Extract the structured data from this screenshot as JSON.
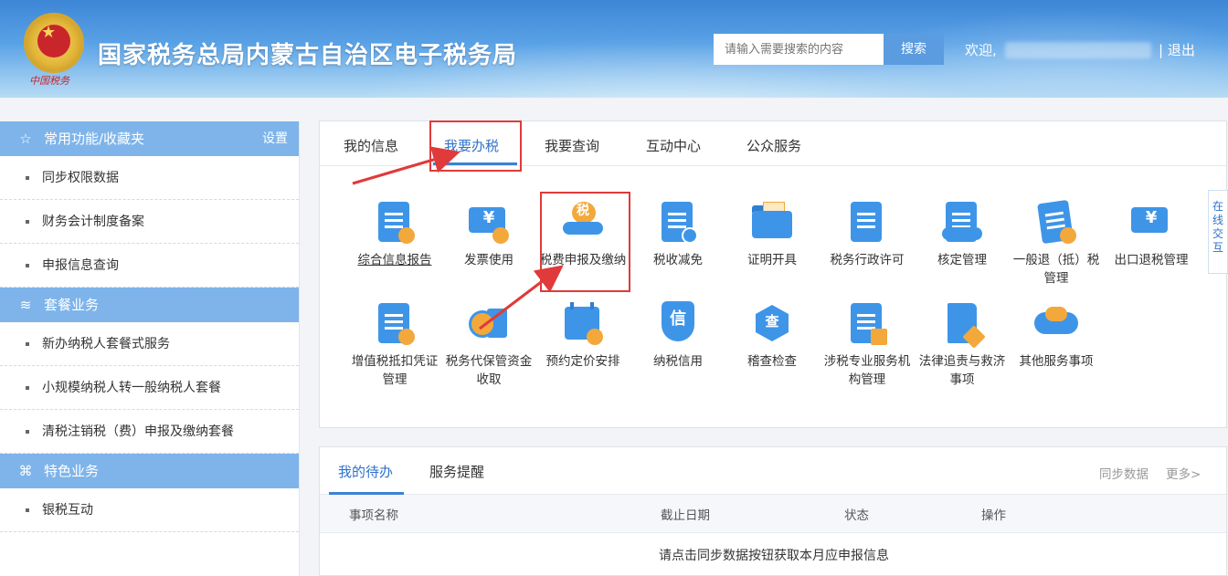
{
  "header": {
    "emblem_caption": "中国税务",
    "title": "国家税务总局内蒙古自治区电子税务局",
    "search": {
      "placeholder": "请输入需要搜索的内容",
      "button": "搜索"
    },
    "welcome": "欢迎,",
    "logout": "| 退出"
  },
  "sidebar": {
    "sections": [
      {
        "title": "常用功能/收藏夹",
        "icon": "star-icon",
        "setting": "设置",
        "items": [
          "同步权限数据",
          "财务会计制度备案",
          "申报信息查询"
        ]
      },
      {
        "title": "套餐业务",
        "icon": "layers-icon",
        "items": [
          "新办纳税人套餐式服务",
          "小规模纳税人转一般纳税人套餐",
          "清税注销税（费）申报及缴纳套餐"
        ]
      },
      {
        "title": "特色业务",
        "icon": "command-icon",
        "items": [
          "银税互动"
        ]
      }
    ]
  },
  "main": {
    "tabs": [
      "我的信息",
      "我要办税",
      "我要查询",
      "互动中心",
      "公众服务"
    ],
    "active_tab": "我要办税",
    "grid": {
      "row1": [
        "综合信息报告",
        "发票使用",
        "税费申报及缴纳",
        "税收减免",
        "证明开具",
        "税务行政许可",
        "核定管理",
        "一般退（抵）税管理",
        "出口退税管理"
      ],
      "row2": [
        "增值税抵扣凭证管理",
        "税务代保管资金收取",
        "预约定价安排",
        "纳税信用",
        "稽查检查",
        "涉税专业服务机构管理",
        "法律追责与救济事项",
        "其他服务事项"
      ],
      "icon_texts": {
        "tax_return": "税",
        "credit": "信",
        "audit": "查",
        "invoice": "¥",
        "export": "¥",
        "escrow": "¥"
      }
    },
    "float_tab": "在线交互"
  },
  "todo": {
    "tabs": [
      "我的待办",
      "服务提醒"
    ],
    "actions": [
      "同步数据",
      "更多>"
    ],
    "columns": [
      "事项名称",
      "截止日期",
      "状态",
      "操作"
    ],
    "empty_message": "请点击同步数据按钮获取本月应申报信息"
  },
  "colors": {
    "accent": "#3b82d6",
    "highlight": "#e03a3a",
    "sidebar_header": "#7eb4ea",
    "icon_blue": "#3e95e8",
    "icon_orange": "#f3a83b"
  }
}
